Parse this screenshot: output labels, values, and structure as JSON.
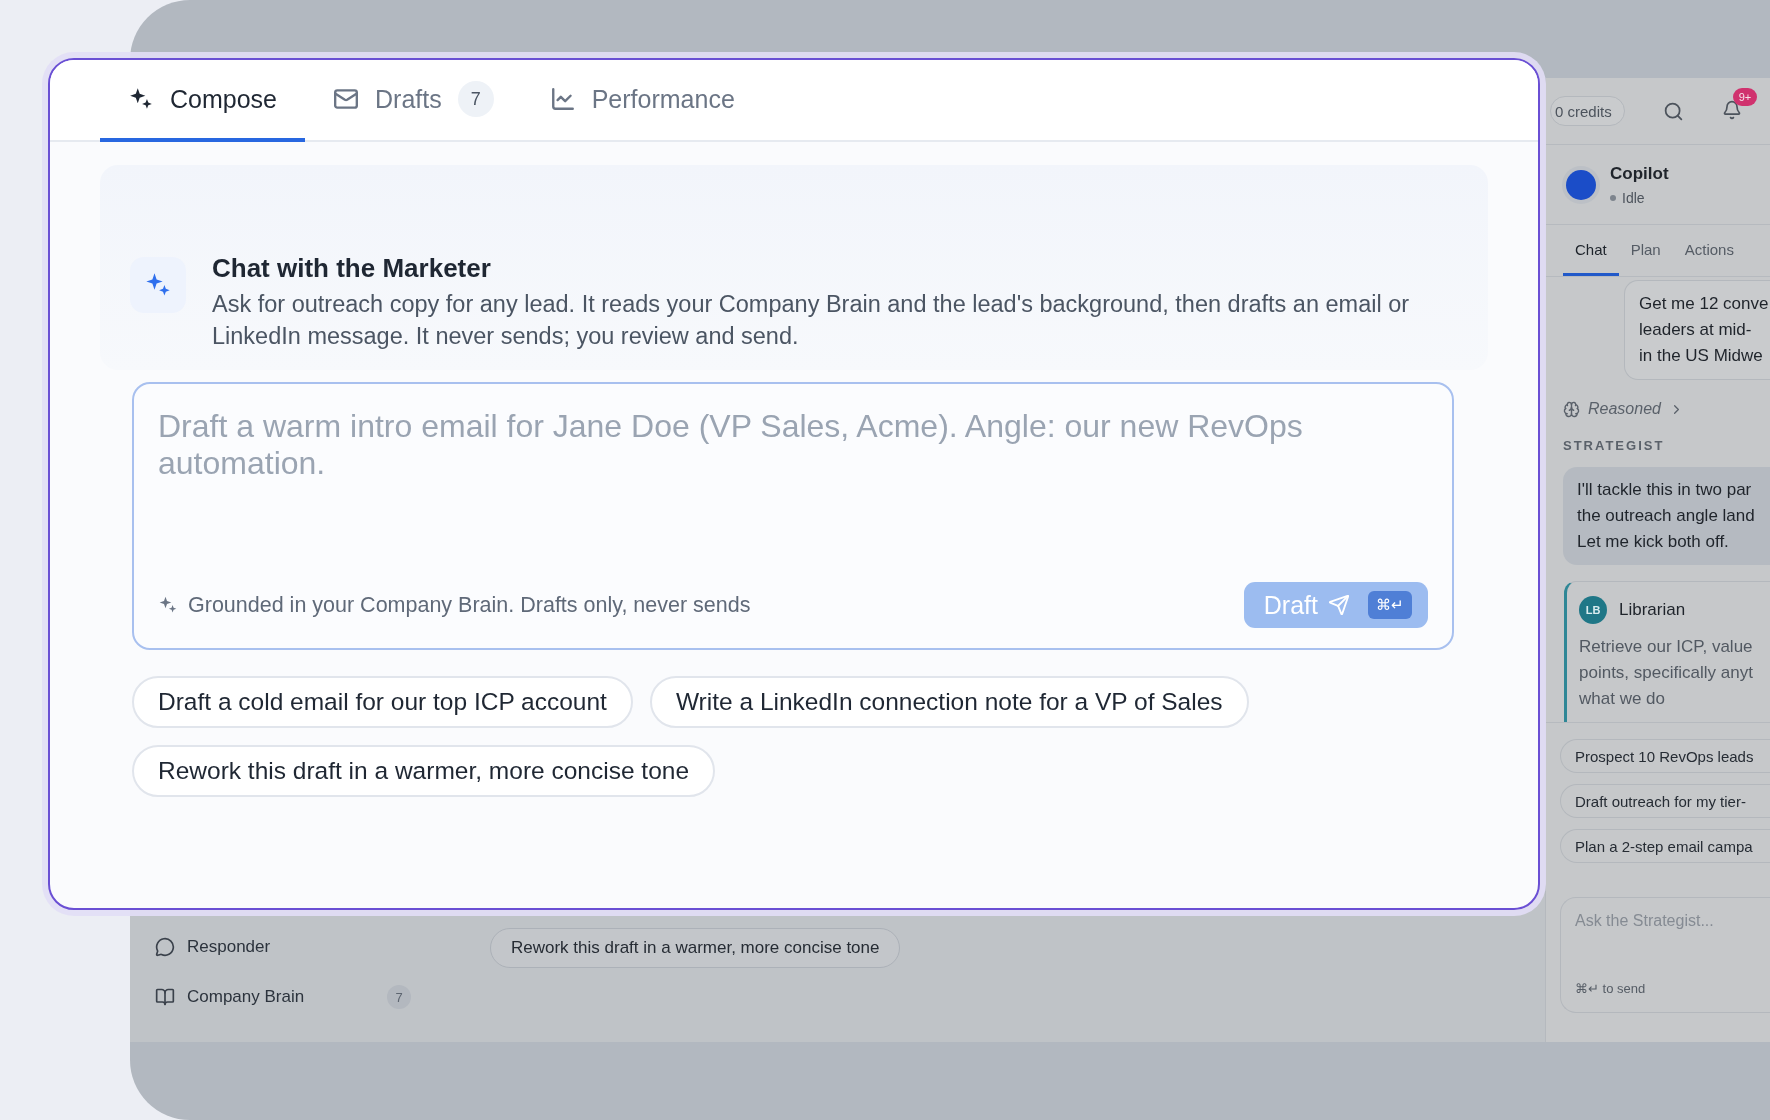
{
  "background": {
    "sidebar": {
      "items": [
        {
          "label": "Responder"
        },
        {
          "label": "Company Brain",
          "badge": "7"
        }
      ]
    },
    "main_suggestion": "Rework this draft in a warmer, more concise tone",
    "right_panel": {
      "credits": "0 credits",
      "notifications": "9+",
      "agent": {
        "name": "Copilot",
        "status": "Idle"
      },
      "tabs": [
        {
          "label": "Chat",
          "selected": true
        },
        {
          "label": "Plan",
          "selected": false
        },
        {
          "label": "Actions",
          "selected": false
        }
      ],
      "messages": [
        {
          "kind": "user",
          "lines": [
            "Get me 12 conve",
            "leaders at mid-",
            "in the US Midwe"
          ]
        },
        {
          "kind": "reasoning",
          "label": "Reasoned"
        },
        {
          "kind": "role",
          "label": "STRATEGIST"
        },
        {
          "kind": "assistant",
          "lines": [
            "I'll tackle this in two par",
            "the outreach angle land",
            "Let me kick both off."
          ]
        },
        {
          "kind": "delegate",
          "initials": "LB",
          "name": "Librarian",
          "lines": [
            "Retrieve our ICP, value",
            "points, specifically anyt",
            "what we do"
          ]
        }
      ],
      "suggestions": [
        "Prospect 10 RevOps leads",
        "Draft outreach for my tier-",
        "Plan a 2-step email campa"
      ],
      "input": {
        "placeholder": "Ask the Strategist...",
        "hint": "⌘↵ to send"
      }
    }
  },
  "modal": {
    "tabs": [
      {
        "label": "Compose",
        "selected": true
      },
      {
        "label": "Drafts",
        "badge": "7",
        "selected": false
      },
      {
        "label": "Performance",
        "selected": false
      }
    ],
    "intro": {
      "title": "Chat with the Marketer",
      "description": "Ask for outreach copy for any lead. It reads your Company Brain and the lead's background, then drafts an email or LinkedIn message. It never sends; you review and send."
    },
    "composer": {
      "placeholder": "Draft a warm intro email for Jane Doe (VP Sales, Acme). Angle: our new RevOps automation.",
      "hint": "Grounded in your Company Brain. Drafts only, never sends",
      "button": {
        "label": "Draft",
        "shortcut": "⌘↵"
      }
    },
    "suggestions": [
      "Draft a cold email for our top ICP account",
      "Write a LinkedIn connection note for a VP of Sales",
      "Rework this draft in a warmer, more concise tone"
    ]
  }
}
